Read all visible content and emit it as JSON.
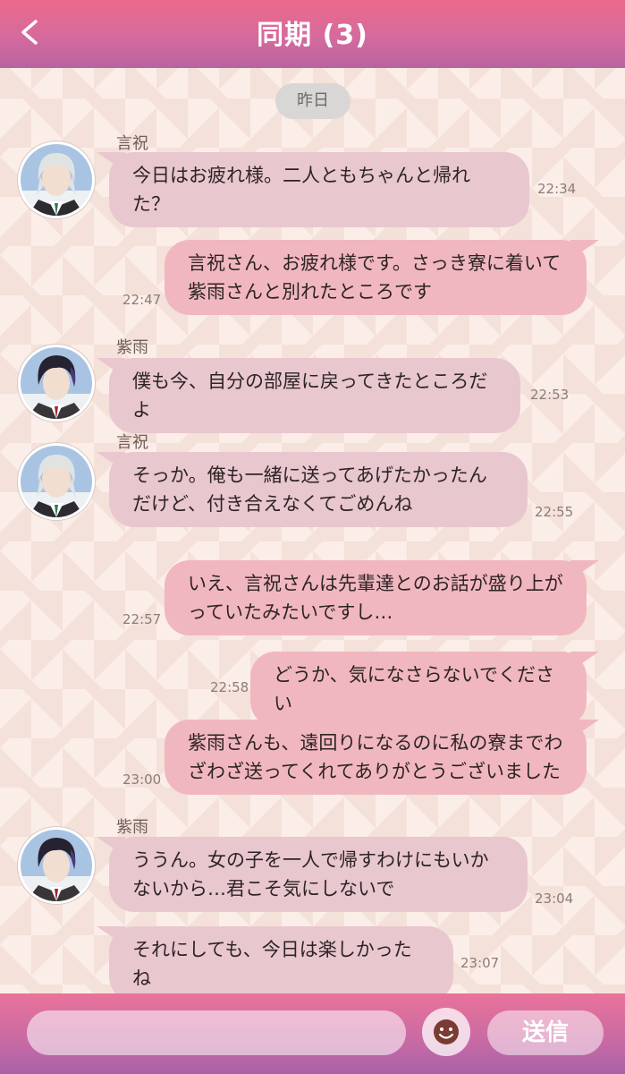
{
  "header": {
    "title": "同期 (3)",
    "back_icon": "back-chevron-icon"
  },
  "date_divider": "昨日",
  "chat": {
    "names": {
      "kotoyoi": "言祝",
      "shigure": "紫雨"
    },
    "messages": [
      {
        "sender": "言祝",
        "text": "今日はお疲れ様。二人ともちゃんと帰れた？",
        "time": "22:34"
      },
      {
        "sender": "",
        "text": "言祝さん、お疲れ様です。さっき寮に着いて紫雨さんと別れたところです",
        "time": "22:47"
      },
      {
        "sender": "紫雨",
        "text": "僕も今、自分の部屋に戻ってきたところだよ",
        "time": "22:53"
      },
      {
        "sender": "言祝",
        "text": "そっか。俺も一緒に送ってあげたかったんだけど、付き合えなくてごめんね",
        "time": "22:55"
      },
      {
        "sender": "",
        "text": "いえ、言祝さんは先輩達とのお話が盛り上がっていたみたいですし…",
        "time": "22:57"
      },
      {
        "sender": "",
        "text": "どうか、気になさらないでください",
        "time": "22:58"
      },
      {
        "sender": "",
        "text": "紫雨さんも、遠回りになるのに私の寮までわざわざ送ってくれてありがとうございました",
        "time": "23:00"
      },
      {
        "sender": "紫雨",
        "text": "ううん。女の子を一人で帰すわけにもいかないから…君こそ気にしないで",
        "time": "23:04"
      },
      {
        "sender": "紫雨",
        "text": "それにしても、今日は楽しかったね",
        "time": "23:07"
      }
    ]
  },
  "footer": {
    "input_value": "",
    "input_placeholder": "",
    "emoji_icon": "smiley-icon",
    "send_label": "送信"
  },
  "colors": {
    "header_top": "#ec6a8a",
    "header_bottom": "#b8649f",
    "bubble_incoming": "#e9c7cf",
    "bubble_outgoing": "#f1b7c0",
    "background": "#fbeee8"
  }
}
